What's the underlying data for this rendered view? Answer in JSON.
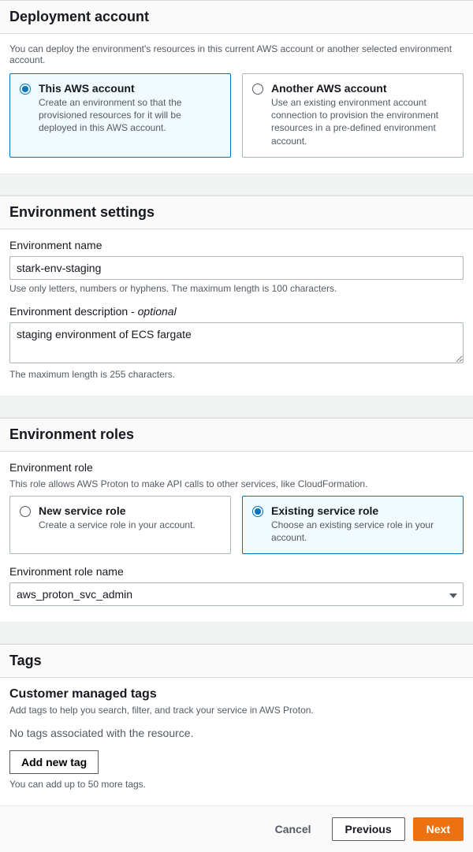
{
  "deployment": {
    "title": "Deployment account",
    "help": "You can deploy the environment's resources in this current AWS account or another selected environment account.",
    "options": [
      {
        "title": "This AWS account",
        "desc": "Create an environment so that the provisioned resources for it will be deployed in this AWS account."
      },
      {
        "title": "Another AWS account",
        "desc": "Use an existing environment account connection to provision the environment resources in a pre-defined environment account."
      }
    ]
  },
  "envSettings": {
    "title": "Environment settings",
    "nameLabel": "Environment name",
    "nameValue": "stark-env-staging",
    "nameHint": "Use only letters, numbers or hyphens. The maximum length is 100 characters.",
    "descLabel": "Environment description - ",
    "descOptional": "optional",
    "descValue": "staging environment of ECS fargate",
    "descHint": "The maximum length is 255 characters."
  },
  "envRoles": {
    "title": "Environment roles",
    "roleLabel": "Environment role",
    "roleHelp": "This role allows AWS Proton to make API calls to other services, like CloudFormation.",
    "options": [
      {
        "title": "New service role",
        "desc": "Create a service role in your account."
      },
      {
        "title": "Existing service role",
        "desc": "Choose an existing service role in your account."
      }
    ],
    "roleNameLabel": "Environment role name",
    "roleNameValue": "aws_proton_svc_admin"
  },
  "tags": {
    "title": "Tags",
    "subTitle": "Customer managed tags",
    "help": "Add tags to help you search, filter, and track your service in AWS Proton.",
    "empty": "No tags associated with the resource.",
    "addBtn": "Add new tag",
    "limit": "You can add up to 50 more tags."
  },
  "footer": {
    "cancel": "Cancel",
    "previous": "Previous",
    "next": "Next"
  }
}
